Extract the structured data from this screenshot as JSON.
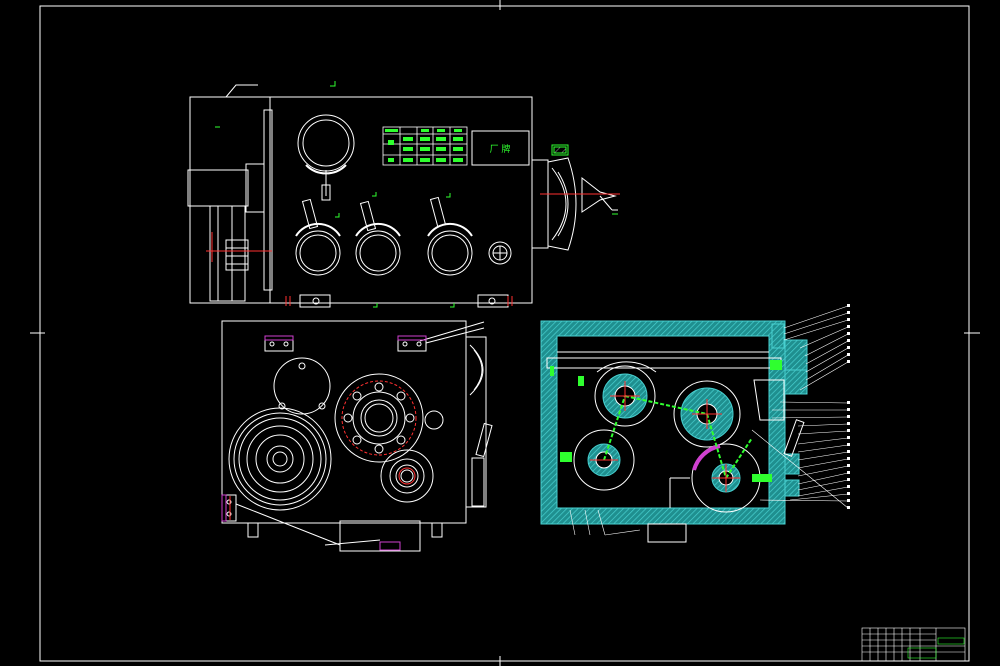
{
  "drawing": {
    "colors": {
      "background": "#000000",
      "line": "#ffffff",
      "accent_red": "#ff3030",
      "accent_green": "#2fff2f",
      "section_cyan": "#30b4b4",
      "magenta": "#d040d0"
    },
    "front_view": {
      "label": "厂 牌"
    },
    "title_block": {
      "text": ""
    }
  }
}
